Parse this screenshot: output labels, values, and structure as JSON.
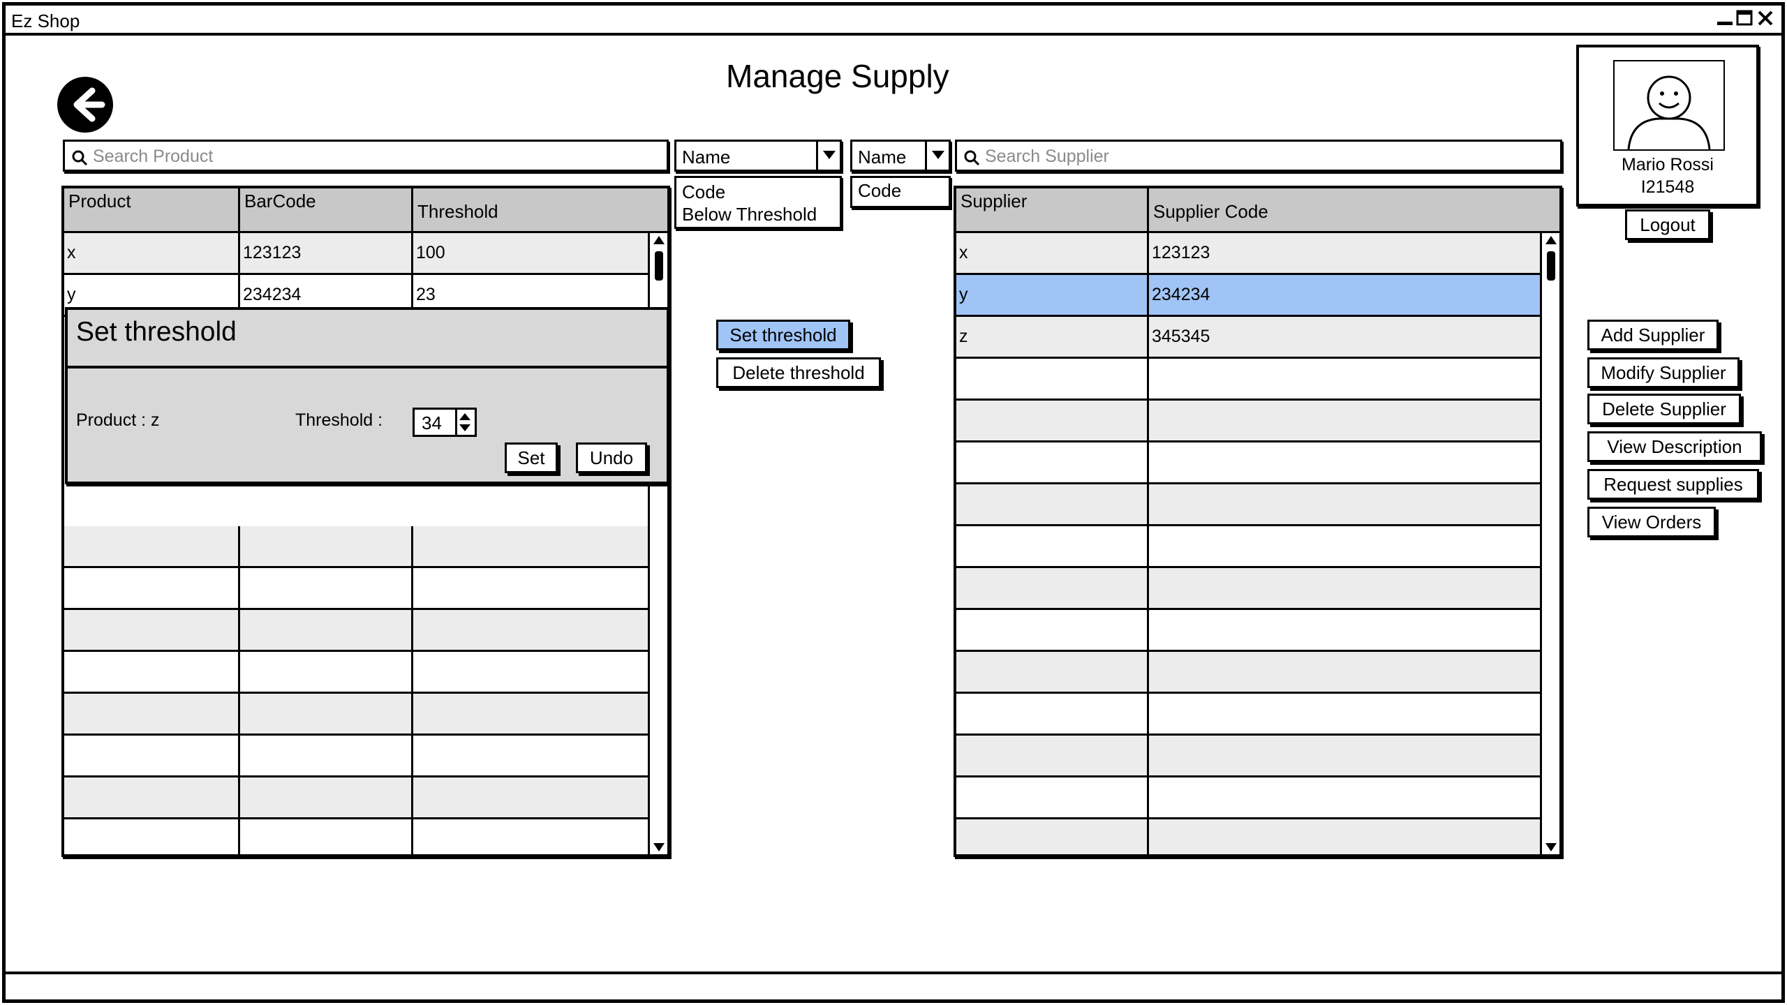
{
  "window": {
    "title": "Ez Shop"
  },
  "page": {
    "title": "Manage Supply"
  },
  "product_search": {
    "placeholder": "Search Product"
  },
  "product_filter": {
    "selected": "Name",
    "options": [
      "Code",
      "Below Threshold"
    ]
  },
  "product_table": {
    "headers": [
      "Product",
      "BarCode",
      "Threshold"
    ],
    "rows": [
      [
        "x",
        "123123",
        "100"
      ],
      [
        "y",
        "234234",
        "23"
      ]
    ]
  },
  "threshold_dialog": {
    "title": "Set threshold",
    "product_label": "Product : z",
    "threshold_label": "Threshold :",
    "threshold_value": "34",
    "set_label": "Set",
    "undo_label": "Undo"
  },
  "middle_actions": {
    "set_threshold": "Set threshold",
    "delete_threshold": "Delete threshold"
  },
  "supplier_filter": {
    "selected": "Name",
    "options": [
      "Code"
    ]
  },
  "supplier_search": {
    "placeholder": "Search Supplier"
  },
  "supplier_table": {
    "headers": [
      "Supplier",
      "Supplier Code"
    ],
    "rows": [
      [
        "x",
        "123123"
      ],
      [
        "y",
        "234234"
      ],
      [
        "z",
        "345345"
      ]
    ],
    "selected_row": 1
  },
  "user": {
    "name": "Mario Rossi",
    "id": "I21548",
    "logout_label": "Logout"
  },
  "supplier_actions": {
    "add": "Add Supplier",
    "modify": "Modify Supplier",
    "delete": "Delete Supplier",
    "view_description": "View Description",
    "request_supplies": "Request supplies",
    "view_orders": "View Orders"
  },
  "colors": {
    "header_bg": "#c8c8c8",
    "row_alt": "#ececec",
    "selection": "#a0c4f5",
    "dialog_bg": "#d8d8d8"
  },
  "icons": [
    "back-arrow-icon",
    "search-icon",
    "chevron-down-icon",
    "minimize-icon",
    "maximize-icon",
    "close-icon",
    "user-avatar-icon"
  ]
}
